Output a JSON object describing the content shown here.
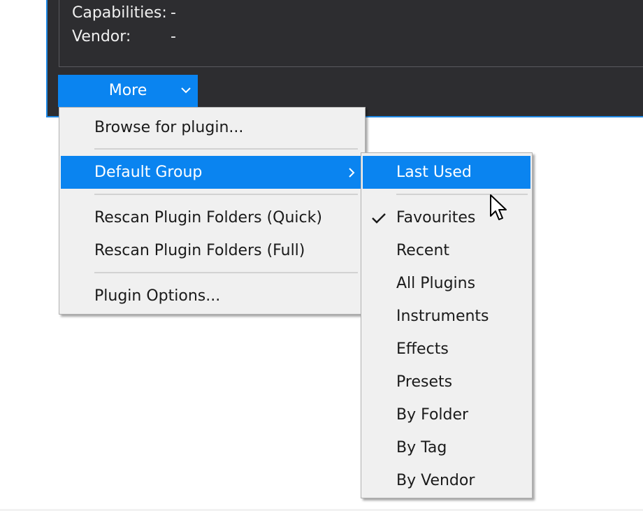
{
  "info": {
    "capabilities_label": "Capabilities:",
    "capabilities_value": "-",
    "vendor_label": "Vendor:",
    "vendor_value": "-"
  },
  "more_button": {
    "label": "More",
    "icon": "chevron-down-icon"
  },
  "main_menu": {
    "browse": "Browse for plugin...",
    "default_group": "Default Group",
    "rescan_quick": "Rescan Plugin Folders (Quick)",
    "rescan_full": "Rescan Plugin Folders (Full)",
    "plugin_options": "Plugin Options..."
  },
  "sub_menu": {
    "items": [
      {
        "label": "Last Used",
        "highlighted": true,
        "checked": false
      },
      {
        "label": "Favourites",
        "highlighted": false,
        "checked": true
      },
      {
        "label": "Recent",
        "highlighted": false,
        "checked": false
      },
      {
        "label": "All Plugins",
        "highlighted": false,
        "checked": false
      },
      {
        "label": "Instruments",
        "highlighted": false,
        "checked": false
      },
      {
        "label": "Effects",
        "highlighted": false,
        "checked": false
      },
      {
        "label": "Presets",
        "highlighted": false,
        "checked": false
      },
      {
        "label": "By Folder",
        "highlighted": false,
        "checked": false
      },
      {
        "label": "By Tag",
        "highlighted": false,
        "checked": false
      },
      {
        "label": "By Vendor",
        "highlighted": false,
        "checked": false
      }
    ]
  },
  "colors": {
    "accent": "#0a84f0",
    "window_bg": "#2d2d30",
    "menu_bg": "#f0f0f0",
    "window_border": "#1e88e5"
  }
}
